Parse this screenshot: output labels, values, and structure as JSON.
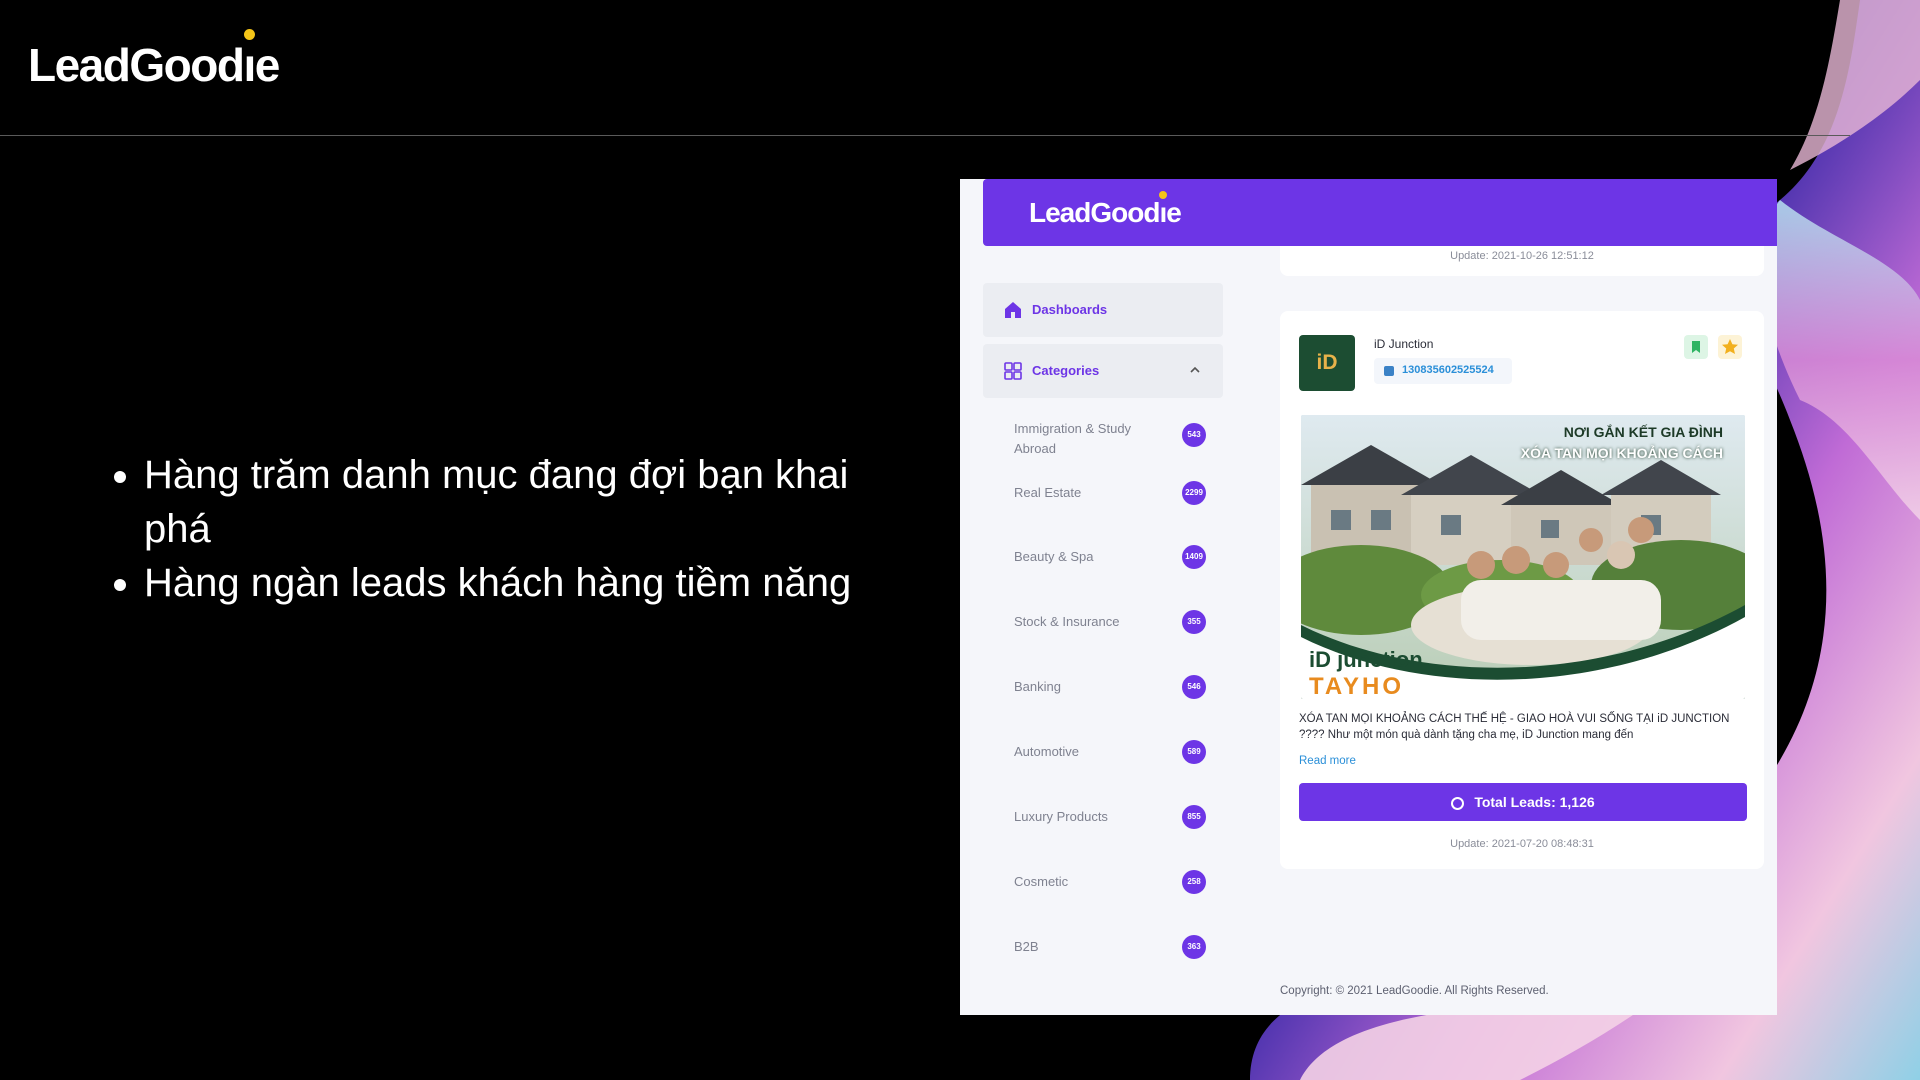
{
  "slide": {
    "logo": "LeadGoodie",
    "bullets": [
      "Hàng trăm danh mục đang đợi bạn khai phá",
      "Hàng ngàn leads khách hàng tiềm năng"
    ]
  },
  "app": {
    "header_logo": "LeadGoodie",
    "top_card_update": "Update: 2021-10-26 12:51:12",
    "nav": {
      "dashboards": "Dashboards",
      "categories": "Categories"
    },
    "categories": [
      {
        "label": "Immigration & Study Abroad",
        "count": "543"
      },
      {
        "label": "Real Estate",
        "count": "2299"
      },
      {
        "label": "Beauty & Spa",
        "count": "1409"
      },
      {
        "label": "Stock & Insurance",
        "count": "355"
      },
      {
        "label": "Banking",
        "count": "546"
      },
      {
        "label": "Automotive",
        "count": "589"
      },
      {
        "label": "Luxury Products",
        "count": "855"
      },
      {
        "label": "Cosmetic",
        "count": "258"
      },
      {
        "label": "B2B",
        "count": "363"
      }
    ],
    "card": {
      "brand_logo": "iD",
      "brand_name": "iD Junction",
      "fb_id": "130835602525524",
      "ad_tagline_1": "NƠI GẮN KẾT GIA ĐÌNH",
      "ad_tagline_2": "XÓA TAN MỌI KHOẢNG CÁCH",
      "ad_brand": "iD junction",
      "ad_brand_sub": "TAYHO",
      "description": "XÓA TAN MỌI KHOẢNG CÁCH THẾ HỆ - GIAO HOÀ VUI SỐNG TẠI iD JUNCTION ???? Như một món quà dành tặng cha mẹ, iD Junction mang đến",
      "read_more": "Read more",
      "total_leads": "Total Leads: 1,126",
      "update": "Update: 2021-07-20 08:48:31"
    },
    "copyright": "Copyright: © 2021 LeadGoodie. All Rights Reserved."
  },
  "colors": {
    "accent": "#6d35e6",
    "link": "#2a8fd8",
    "brand_green": "#1c4d32"
  },
  "icons": [
    "home-icon",
    "grid-icon",
    "chevron-up-icon",
    "facebook-icon",
    "bookmark-icon",
    "star-icon",
    "target-icon"
  ]
}
